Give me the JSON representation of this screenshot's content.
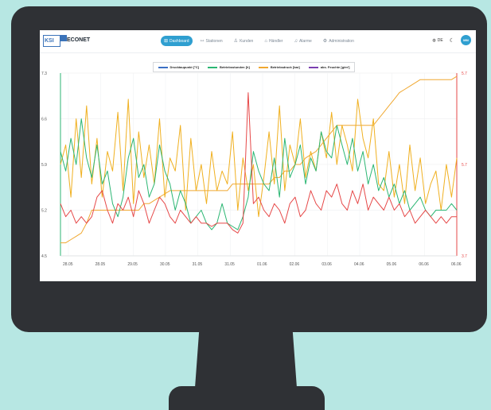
{
  "app": {
    "brand": "ECONET",
    "logo_text": "KSI"
  },
  "nav": {
    "items": [
      {
        "label": "Dashboard",
        "icon": "dashboard-icon",
        "active": true
      },
      {
        "label": "Stationen",
        "icon": "stations-icon",
        "active": false
      },
      {
        "label": "Kunden",
        "icon": "customers-icon",
        "active": false
      },
      {
        "label": "Händler",
        "icon": "dealer-icon",
        "active": false
      },
      {
        "label": "Alarme",
        "icon": "bell-icon",
        "active": false
      },
      {
        "label": "Administration",
        "icon": "gear-icon",
        "active": false
      }
    ],
    "language": "DE",
    "user_initials": "MM"
  },
  "colors": {
    "accent": "#2f9fd0",
    "taupunkt": "#3b6fc4",
    "betriebsstunden": "#2bb673",
    "betriebsdruck": "#f0a830",
    "feuchte": "#7a3fb0",
    "red_series": "#e64848"
  },
  "chart_data": {
    "type": "line",
    "legend": [
      {
        "name": "Drucktaupunkt [°C]",
        "color": "#3b6fc4"
      },
      {
        "name": "Betriebsstunden [h]",
        "color": "#2bb673"
      },
      {
        "name": "Betriebsdruck [bar]",
        "color": "#f0a830"
      },
      {
        "name": "abs. Feuchte [g/m³]",
        "color": "#7a3fb0"
      }
    ],
    "x_ticks": [
      "28.05",
      "28.05",
      "29.05",
      "30.05",
      "31.05",
      "31.05",
      "01.06",
      "02.06",
      "03.06",
      "04.06",
      "05.06",
      "06.06",
      "06.06"
    ],
    "y_left": {
      "ticks": [
        "7.3",
        "6.6",
        "5.9",
        "5.2",
        "4.5"
      ],
      "min": 4.5,
      "max": 7.3,
      "color": "#2bb673"
    },
    "y_right": {
      "ticks": [
        "5.7",
        "5.7",
        "3.7"
      ],
      "color": "#e64848"
    },
    "series": [
      {
        "name": "Betriebsstunden",
        "color": "#f0a830",
        "values": [
          4.7,
          4.7,
          4.75,
          4.8,
          4.85,
          5.0,
          5.2,
          5.2,
          5.2,
          5.2,
          5.2,
          5.2,
          5.2,
          5.2,
          5.2,
          5.2,
          5.3,
          5.3,
          5.35,
          5.4,
          5.45,
          5.5,
          5.5,
          5.5,
          5.5,
          5.5,
          5.5,
          5.5,
          5.5,
          5.5,
          5.5,
          5.5,
          5.5,
          5.6,
          5.6,
          5.6,
          5.6,
          5.6,
          5.6,
          5.6,
          5.6,
          5.7,
          5.7,
          5.8,
          5.8,
          5.9,
          5.9,
          6.0,
          6.05,
          6.1,
          6.2,
          6.3,
          6.4,
          6.5,
          6.5,
          6.5,
          6.5,
          6.5,
          6.5,
          6.5,
          6.5,
          6.6,
          6.7,
          6.8,
          6.9,
          7.0,
          7.05,
          7.1,
          7.15,
          7.2,
          7.2,
          7.2,
          7.2,
          7.2,
          7.2,
          7.2,
          7.25
        ]
      },
      {
        "name": "Betriebsdruck",
        "color": "#f0b020",
        "values": [
          5.9,
          6.2,
          5.4,
          6.6,
          5.7,
          6.8,
          5.6,
          6.3,
          5.4,
          6.1,
          5.8,
          6.7,
          5.5,
          6.9,
          5.3,
          6.4,
          5.7,
          6.2,
          5.6,
          6.6,
          5.4,
          6.0,
          5.8,
          6.5,
          5.2,
          6.3,
          5.5,
          5.9,
          5.3,
          6.1,
          5.5,
          5.8,
          5.6,
          6.4,
          5.2,
          6.0,
          5.5,
          5.9,
          5.1,
          5.7,
          6.4,
          5.6,
          6.8,
          5.5,
          6.2,
          5.9,
          6.6,
          5.7,
          6.1,
          5.8,
          6.4,
          6.0,
          6.7,
          5.9,
          6.5,
          6.2,
          5.8,
          6.9,
          6.3,
          6.0,
          6.6,
          5.6,
          5.5,
          6.1,
          5.4,
          5.9,
          5.3,
          6.2,
          5.5,
          6.0,
          5.3,
          5.6,
          5.8,
          5.2,
          5.9,
          5.4,
          6.0
        ]
      },
      {
        "name": "Drucktaupunkt",
        "color": "#2bb673",
        "values": [
          6.1,
          5.8,
          6.3,
          5.9,
          6.6,
          6.0,
          5.7,
          6.2,
          5.6,
          5.8,
          5.3,
          5.1,
          5.4,
          6.0,
          6.3,
          5.7,
          5.9,
          5.4,
          5.6,
          6.2,
          5.8,
          5.6,
          5.2,
          5.5,
          5.3,
          5.0,
          5.1,
          5.2,
          5.0,
          4.9,
          5.0,
          5.3,
          5.0,
          4.95,
          4.9,
          5.1,
          5.4,
          6.1,
          5.8,
          5.6,
          5.5,
          6.0,
          5.4,
          6.3,
          5.7,
          5.9,
          6.2,
          5.6,
          6.0,
          5.8,
          6.4,
          6.1,
          6.0,
          6.5,
          6.2,
          5.9,
          6.3,
          5.8,
          6.1,
          5.6,
          5.9,
          5.5,
          5.7,
          5.4,
          5.6,
          5.3,
          5.5,
          5.2,
          5.3,
          5.4,
          5.2,
          5.1,
          5.2,
          5.2,
          5.2,
          5.3,
          5.2
        ]
      },
      {
        "name": "Temperatur",
        "color": "#e64848",
        "values": [
          5.3,
          5.1,
          5.2,
          5.0,
          5.1,
          5.0,
          5.1,
          5.4,
          5.5,
          5.2,
          5.0,
          5.3,
          5.2,
          5.4,
          5.1,
          5.5,
          5.3,
          5.0,
          5.2,
          5.4,
          5.3,
          5.1,
          5.0,
          5.2,
          5.1,
          5.0,
          5.1,
          5.0,
          5.0,
          4.95,
          5.0,
          5.0,
          5.0,
          4.9,
          4.85,
          5.0,
          7.0,
          5.3,
          5.4,
          5.2,
          5.1,
          5.3,
          5.2,
          5.0,
          5.3,
          5.4,
          5.1,
          5.2,
          5.5,
          5.3,
          5.2,
          5.5,
          5.4,
          5.6,
          5.3,
          5.2,
          5.5,
          5.3,
          5.6,
          5.2,
          5.4,
          5.3,
          5.2,
          5.4,
          5.2,
          5.3,
          5.1,
          5.2,
          5.0,
          5.1,
          5.2,
          5.1,
          5.0,
          5.1,
          5.0,
          5.1,
          5.1
        ]
      }
    ]
  }
}
